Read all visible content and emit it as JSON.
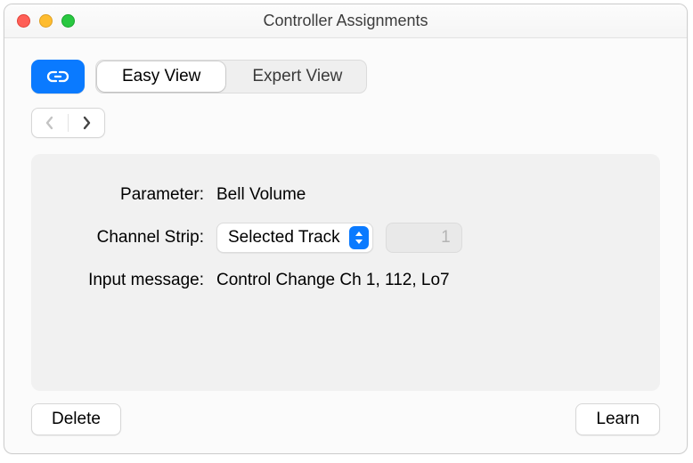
{
  "window": {
    "title": "Controller Assignments"
  },
  "toolbar": {
    "view_tabs": [
      "Easy View",
      "Expert View"
    ],
    "selected_tab": 0
  },
  "nav": {
    "back_enabled": false,
    "fwd_enabled": true
  },
  "fields": {
    "parameter": {
      "label": "Parameter:",
      "value": "Bell Volume"
    },
    "channel": {
      "label": "Channel Strip:",
      "popup_value": "Selected Track",
      "num_value": "1"
    },
    "input": {
      "label": "Input message:",
      "value": "Control Change Ch 1, 112, Lo7"
    }
  },
  "footer": {
    "delete": "Delete",
    "learn": "Learn"
  }
}
